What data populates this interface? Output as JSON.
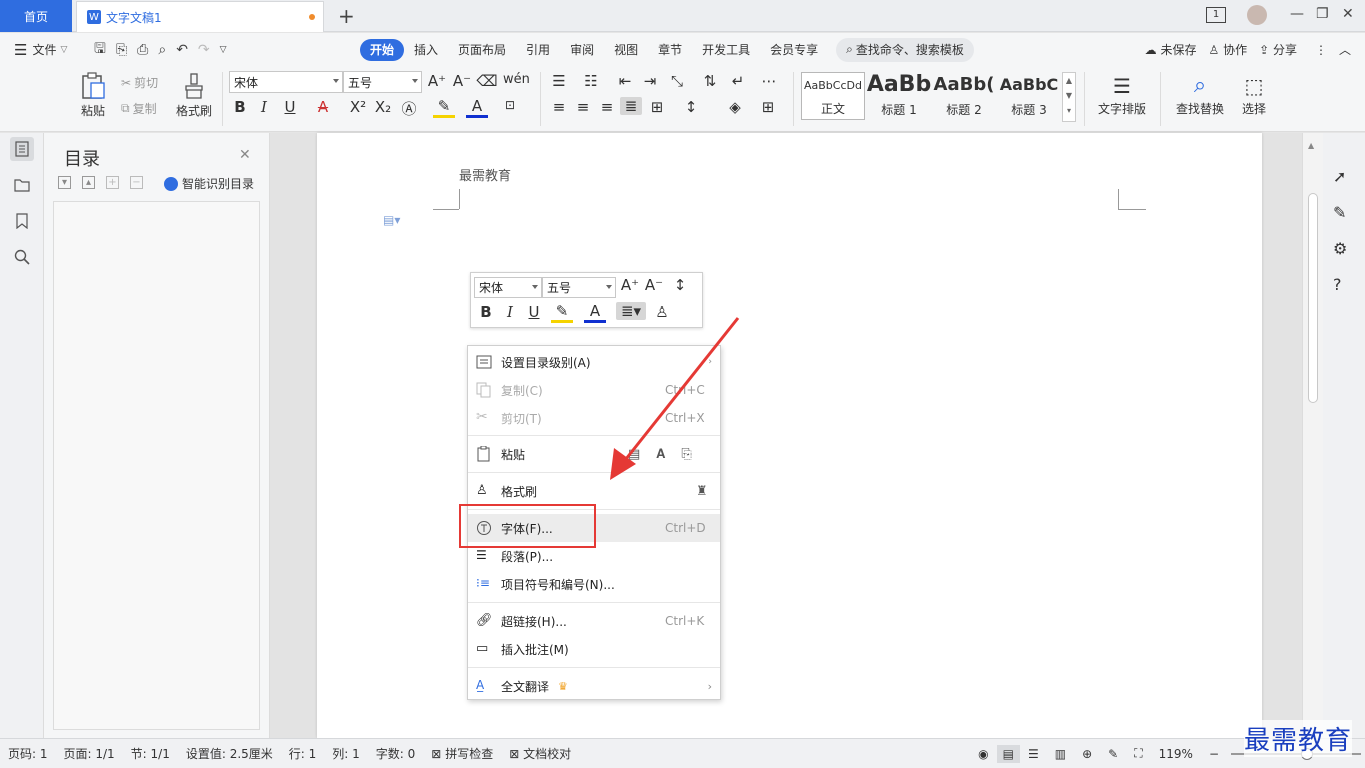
{
  "titlebar": {
    "home_tab": "首页",
    "doc_tab": "文字文稿1",
    "doc_icon": "W",
    "new_tab_icon": "+",
    "page_count_badge": "1"
  },
  "menubar": {
    "file": "文件",
    "tabs": [
      "开始",
      "插入",
      "页面布局",
      "引用",
      "审阅",
      "视图",
      "章节",
      "开发工具",
      "会员专享"
    ],
    "active_tab": "开始",
    "search_placeholder": "查找命令、搜索模板",
    "unsaved": "未保存",
    "collaborate": "协作",
    "share": "分享"
  },
  "ribbon": {
    "paste": "粘贴",
    "cut": "剪切",
    "copy": "复制",
    "format_painter": "格式刷",
    "font_name": "宋体",
    "font_size": "五号",
    "styles": [
      {
        "preview": "AaBbCcDd",
        "name": "正文"
      },
      {
        "preview": "AaBb",
        "name": "标题 1"
      },
      {
        "preview": "AaBb(",
        "name": "标题 2"
      },
      {
        "preview": "AaBbC",
        "name": "标题 3"
      }
    ],
    "text_layout": "文字排版",
    "find_replace": "查找替换",
    "select": "选择"
  },
  "toc": {
    "title": "目录",
    "smart_toc": "智能识别目录"
  },
  "document": {
    "header_text": "最需教育"
  },
  "minibar": {
    "font_name": "宋体",
    "font_size": "五号"
  },
  "context_menu": {
    "items": [
      {
        "label": "设置目录级别(A)",
        "shortcut": "",
        "disabled": false
      },
      {
        "label": "复制(C)",
        "shortcut": "Ctrl+C",
        "disabled": true
      },
      {
        "label": "剪切(T)",
        "shortcut": "Ctrl+X",
        "disabled": true
      },
      {
        "label": "粘贴",
        "shortcut": "",
        "disabled": false
      },
      {
        "label": "格式刷",
        "shortcut": "",
        "disabled": false
      },
      {
        "label": "字体(F)...",
        "shortcut": "Ctrl+D",
        "disabled": false
      },
      {
        "label": "段落(P)...",
        "shortcut": "",
        "disabled": false
      },
      {
        "label": "项目符号和编号(N)...",
        "shortcut": "",
        "disabled": false
      },
      {
        "label": "超链接(H)...",
        "shortcut": "Ctrl+K",
        "disabled": false
      },
      {
        "label": "插入批注(M)",
        "shortcut": "",
        "disabled": false
      },
      {
        "label": "全文翻译",
        "shortcut": "",
        "disabled": false
      }
    ]
  },
  "statusbar": {
    "page_no": "页码: 1",
    "pages": "页面: 1/1",
    "section": "节: 1/1",
    "setting": "设置值: 2.5厘米",
    "row": "行: 1",
    "col": "列: 1",
    "word_count": "字数: 0",
    "spell_check": "拼写检查",
    "doc_proof": "文档校对",
    "zoom": "119%"
  },
  "watermark": "最需教育",
  "colors": {
    "accent": "#2f6de0",
    "annotation": "#e53935"
  }
}
